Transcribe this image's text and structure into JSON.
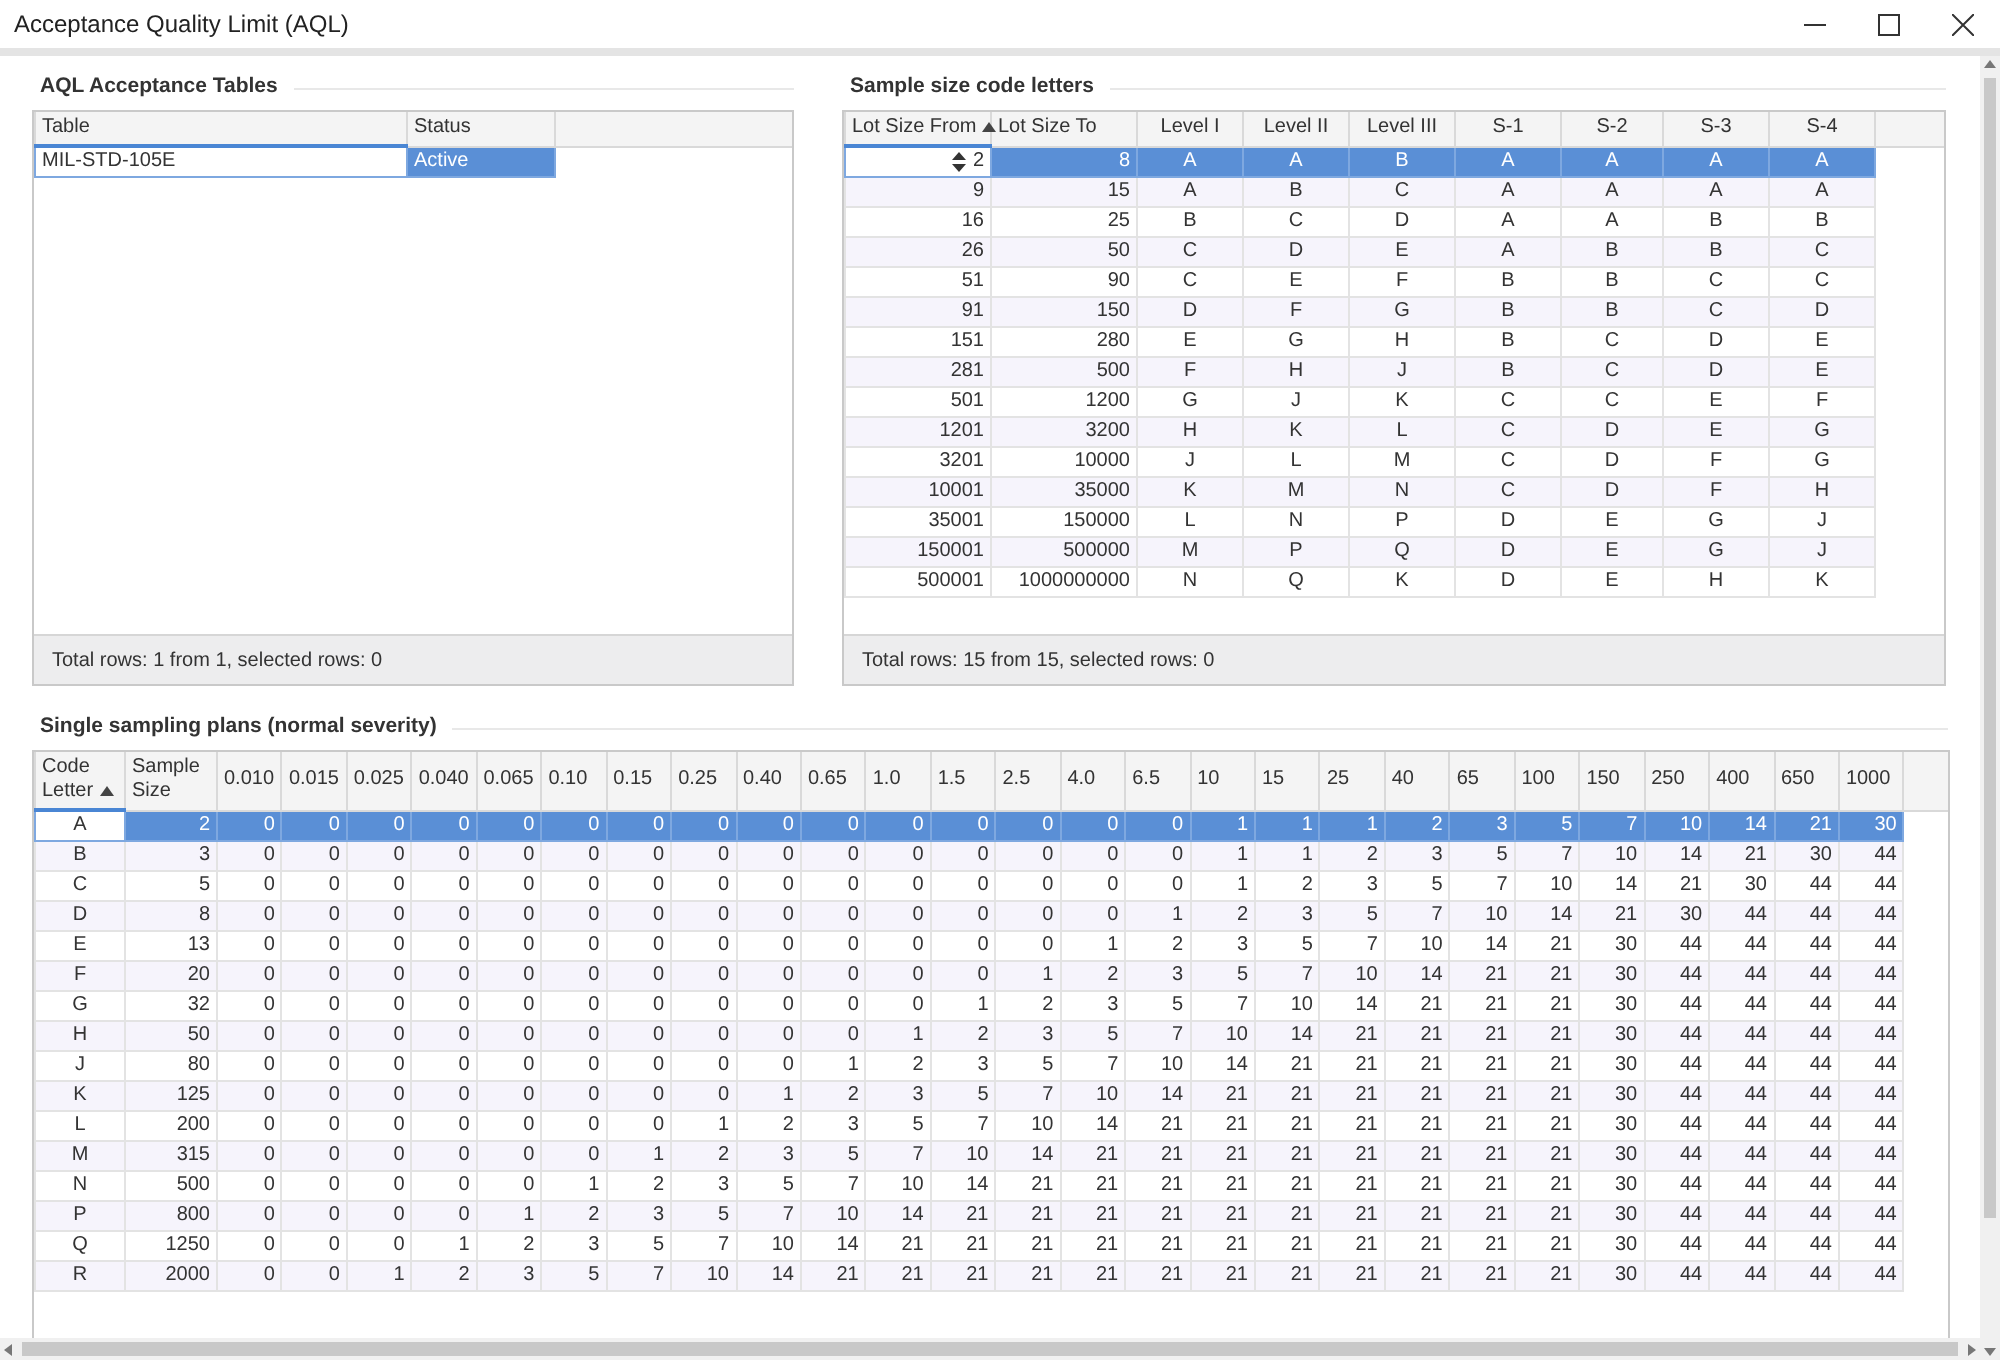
{
  "window": {
    "title": "Acceptance Quality Limit (AQL)"
  },
  "acceptance_tables": {
    "title": "AQL Acceptance Tables",
    "columns": [
      {
        "label": "Table",
        "focused": true
      },
      {
        "label": "Status",
        "focused": false
      }
    ],
    "rows": [
      {
        "cells": [
          "MIL-STD-105E",
          "Active"
        ],
        "selected": true
      }
    ],
    "footer": "Total rows: 1 from 1, selected rows: 0"
  },
  "sample_size_code_letters": {
    "title": "Sample size code letters",
    "spin_editor": true,
    "columns": [
      {
        "label": "Lot Size From",
        "focused": true,
        "sorted_ascending": true
      },
      {
        "label": "Lot Size To",
        "focused": false
      },
      {
        "label": "Level I",
        "focused": false
      },
      {
        "label": "Level II",
        "focused": false
      },
      {
        "label": "Level III",
        "focused": false
      },
      {
        "label": "S-1",
        "focused": false
      },
      {
        "label": "S-2",
        "focused": false
      },
      {
        "label": "S-3",
        "focused": false
      },
      {
        "label": "S-4",
        "focused": false
      }
    ],
    "rows": [
      {
        "cells": [
          "2",
          "8",
          "A",
          "A",
          "B",
          "A",
          "A",
          "A",
          "A"
        ],
        "selected": true
      },
      {
        "cells": [
          "9",
          "15",
          "A",
          "B",
          "C",
          "A",
          "A",
          "A",
          "A"
        ],
        "selected": false
      },
      {
        "cells": [
          "16",
          "25",
          "B",
          "C",
          "D",
          "A",
          "A",
          "B",
          "B"
        ],
        "selected": false
      },
      {
        "cells": [
          "26",
          "50",
          "C",
          "D",
          "E",
          "A",
          "B",
          "B",
          "C"
        ],
        "selected": false
      },
      {
        "cells": [
          "51",
          "90",
          "C",
          "E",
          "F",
          "B",
          "B",
          "C",
          "C"
        ],
        "selected": false
      },
      {
        "cells": [
          "91",
          "150",
          "D",
          "F",
          "G",
          "B",
          "B",
          "C",
          "D"
        ],
        "selected": false
      },
      {
        "cells": [
          "151",
          "280",
          "E",
          "G",
          "H",
          "B",
          "C",
          "D",
          "E"
        ],
        "selected": false
      },
      {
        "cells": [
          "281",
          "500",
          "F",
          "H",
          "J",
          "B",
          "C",
          "D",
          "E"
        ],
        "selected": false
      },
      {
        "cells": [
          "501",
          "1200",
          "G",
          "J",
          "K",
          "C",
          "C",
          "E",
          "F"
        ],
        "selected": false
      },
      {
        "cells": [
          "1201",
          "3200",
          "H",
          "K",
          "L",
          "C",
          "D",
          "E",
          "G"
        ],
        "selected": false
      },
      {
        "cells": [
          "3201",
          "10000",
          "J",
          "L",
          "M",
          "C",
          "D",
          "F",
          "G"
        ],
        "selected": false
      },
      {
        "cells": [
          "10001",
          "35000",
          "K",
          "M",
          "N",
          "C",
          "D",
          "F",
          "H"
        ],
        "selected": false
      },
      {
        "cells": [
          "35001",
          "150000",
          "L",
          "N",
          "P",
          "D",
          "E",
          "G",
          "J"
        ],
        "selected": false
      },
      {
        "cells": [
          "150001",
          "500000",
          "M",
          "P",
          "Q",
          "D",
          "E",
          "G",
          "J"
        ],
        "selected": false
      },
      {
        "cells": [
          "500001",
          "1000000000",
          "N",
          "Q",
          "K",
          "D",
          "E",
          "H",
          "K"
        ],
        "selected": false
      }
    ],
    "footer": "Total rows: 15 from 15, selected rows: 0"
  },
  "single_sampling_plans": {
    "title": "Single sampling plans (normal severity)",
    "columns": [
      {
        "label": "Code Letter",
        "focused": true,
        "sorted_ascending": true
      },
      {
        "label": "Sample Size",
        "focused": false
      },
      {
        "label": "0.010",
        "focused": false
      },
      {
        "label": "0.015",
        "focused": false
      },
      {
        "label": "0.025",
        "focused": false
      },
      {
        "label": "0.040",
        "focused": false
      },
      {
        "label": "0.065",
        "focused": false
      },
      {
        "label": "0.10",
        "focused": false
      },
      {
        "label": "0.15",
        "focused": false
      },
      {
        "label": "0.25",
        "focused": false
      },
      {
        "label": "0.40",
        "focused": false
      },
      {
        "label": "0.65",
        "focused": false
      },
      {
        "label": "1.0",
        "focused": false
      },
      {
        "label": "1.5",
        "focused": false
      },
      {
        "label": "2.5",
        "focused": false
      },
      {
        "label": "4.0",
        "focused": false
      },
      {
        "label": "6.5",
        "focused": false
      },
      {
        "label": "10",
        "focused": false
      },
      {
        "label": "15",
        "focused": false
      },
      {
        "label": "25",
        "focused": false
      },
      {
        "label": "40",
        "focused": false
      },
      {
        "label": "65",
        "focused": false
      },
      {
        "label": "100",
        "focused": false
      },
      {
        "label": "150",
        "focused": false
      },
      {
        "label": "250",
        "focused": false
      },
      {
        "label": "400",
        "focused": false
      },
      {
        "label": "650",
        "focused": false
      },
      {
        "label": "1000",
        "focused": false
      }
    ],
    "rows": [
      {
        "cells": [
          "A",
          "2",
          "0",
          "0",
          "0",
          "0",
          "0",
          "0",
          "0",
          "0",
          "0",
          "0",
          "0",
          "0",
          "0",
          "0",
          "0",
          "1",
          "1",
          "1",
          "2",
          "3",
          "5",
          "7",
          "10",
          "14",
          "21",
          "30"
        ],
        "selected": true
      },
      {
        "cells": [
          "B",
          "3",
          "0",
          "0",
          "0",
          "0",
          "0",
          "0",
          "0",
          "0",
          "0",
          "0",
          "0",
          "0",
          "0",
          "0",
          "0",
          "1",
          "1",
          "2",
          "3",
          "5",
          "7",
          "10",
          "14",
          "21",
          "30",
          "44"
        ],
        "selected": false
      },
      {
        "cells": [
          "C",
          "5",
          "0",
          "0",
          "0",
          "0",
          "0",
          "0",
          "0",
          "0",
          "0",
          "0",
          "0",
          "0",
          "0",
          "0",
          "0",
          "1",
          "2",
          "3",
          "5",
          "7",
          "10",
          "14",
          "21",
          "30",
          "44",
          "44"
        ],
        "selected": false
      },
      {
        "cells": [
          "D",
          "8",
          "0",
          "0",
          "0",
          "0",
          "0",
          "0",
          "0",
          "0",
          "0",
          "0",
          "0",
          "0",
          "0",
          "0",
          "1",
          "2",
          "3",
          "5",
          "7",
          "10",
          "14",
          "21",
          "30",
          "44",
          "44",
          "44"
        ],
        "selected": false
      },
      {
        "cells": [
          "E",
          "13",
          "0",
          "0",
          "0",
          "0",
          "0",
          "0",
          "0",
          "0",
          "0",
          "0",
          "0",
          "0",
          "0",
          "1",
          "2",
          "3",
          "5",
          "7",
          "10",
          "14",
          "21",
          "30",
          "44",
          "44",
          "44",
          "44"
        ],
        "selected": false
      },
      {
        "cells": [
          "F",
          "20",
          "0",
          "0",
          "0",
          "0",
          "0",
          "0",
          "0",
          "0",
          "0",
          "0",
          "0",
          "0",
          "1",
          "2",
          "3",
          "5",
          "7",
          "10",
          "14",
          "21",
          "21",
          "30",
          "44",
          "44",
          "44",
          "44"
        ],
        "selected": false
      },
      {
        "cells": [
          "G",
          "32",
          "0",
          "0",
          "0",
          "0",
          "0",
          "0",
          "0",
          "0",
          "0",
          "0",
          "0",
          "1",
          "2",
          "3",
          "5",
          "7",
          "10",
          "14",
          "21",
          "21",
          "21",
          "30",
          "44",
          "44",
          "44",
          "44"
        ],
        "selected": false
      },
      {
        "cells": [
          "H",
          "50",
          "0",
          "0",
          "0",
          "0",
          "0",
          "0",
          "0",
          "0",
          "0",
          "0",
          "1",
          "2",
          "3",
          "5",
          "7",
          "10",
          "14",
          "21",
          "21",
          "21",
          "21",
          "30",
          "44",
          "44",
          "44",
          "44"
        ],
        "selected": false
      },
      {
        "cells": [
          "J",
          "80",
          "0",
          "0",
          "0",
          "0",
          "0",
          "0",
          "0",
          "0",
          "0",
          "1",
          "2",
          "3",
          "5",
          "7",
          "10",
          "14",
          "21",
          "21",
          "21",
          "21",
          "21",
          "30",
          "44",
          "44",
          "44",
          "44"
        ],
        "selected": false
      },
      {
        "cells": [
          "K",
          "125",
          "0",
          "0",
          "0",
          "0",
          "0",
          "0",
          "0",
          "0",
          "1",
          "2",
          "3",
          "5",
          "7",
          "10",
          "14",
          "21",
          "21",
          "21",
          "21",
          "21",
          "21",
          "30",
          "44",
          "44",
          "44",
          "44"
        ],
        "selected": false
      },
      {
        "cells": [
          "L",
          "200",
          "0",
          "0",
          "0",
          "0",
          "0",
          "0",
          "0",
          "1",
          "2",
          "3",
          "5",
          "7",
          "10",
          "14",
          "21",
          "21",
          "21",
          "21",
          "21",
          "21",
          "21",
          "30",
          "44",
          "44",
          "44",
          "44"
        ],
        "selected": false
      },
      {
        "cells": [
          "M",
          "315",
          "0",
          "0",
          "0",
          "0",
          "0",
          "0",
          "1",
          "2",
          "3",
          "5",
          "7",
          "10",
          "14",
          "21",
          "21",
          "21",
          "21",
          "21",
          "21",
          "21",
          "21",
          "30",
          "44",
          "44",
          "44",
          "44"
        ],
        "selected": false
      },
      {
        "cells": [
          "N",
          "500",
          "0",
          "0",
          "0",
          "0",
          "0",
          "1",
          "2",
          "3",
          "5",
          "7",
          "10",
          "14",
          "21",
          "21",
          "21",
          "21",
          "21",
          "21",
          "21",
          "21",
          "21",
          "30",
          "44",
          "44",
          "44",
          "44"
        ],
        "selected": false
      },
      {
        "cells": [
          "P",
          "800",
          "0",
          "0",
          "0",
          "0",
          "1",
          "2",
          "3",
          "5",
          "7",
          "10",
          "14",
          "21",
          "21",
          "21",
          "21",
          "21",
          "21",
          "21",
          "21",
          "21",
          "21",
          "30",
          "44",
          "44",
          "44",
          "44"
        ],
        "selected": false
      },
      {
        "cells": [
          "Q",
          "1250",
          "0",
          "0",
          "0",
          "1",
          "2",
          "3",
          "5",
          "7",
          "10",
          "14",
          "21",
          "21",
          "21",
          "21",
          "21",
          "21",
          "21",
          "21",
          "21",
          "21",
          "21",
          "30",
          "44",
          "44",
          "44",
          "44"
        ],
        "selected": false
      },
      {
        "cells": [
          "R",
          "2000",
          "0",
          "0",
          "1",
          "2",
          "3",
          "5",
          "7",
          "10",
          "14",
          "21",
          "21",
          "21",
          "21",
          "21",
          "21",
          "21",
          "21",
          "21",
          "21",
          "21",
          "21",
          "30",
          "44",
          "44",
          "44",
          "44"
        ],
        "selected": false
      }
    ]
  }
}
